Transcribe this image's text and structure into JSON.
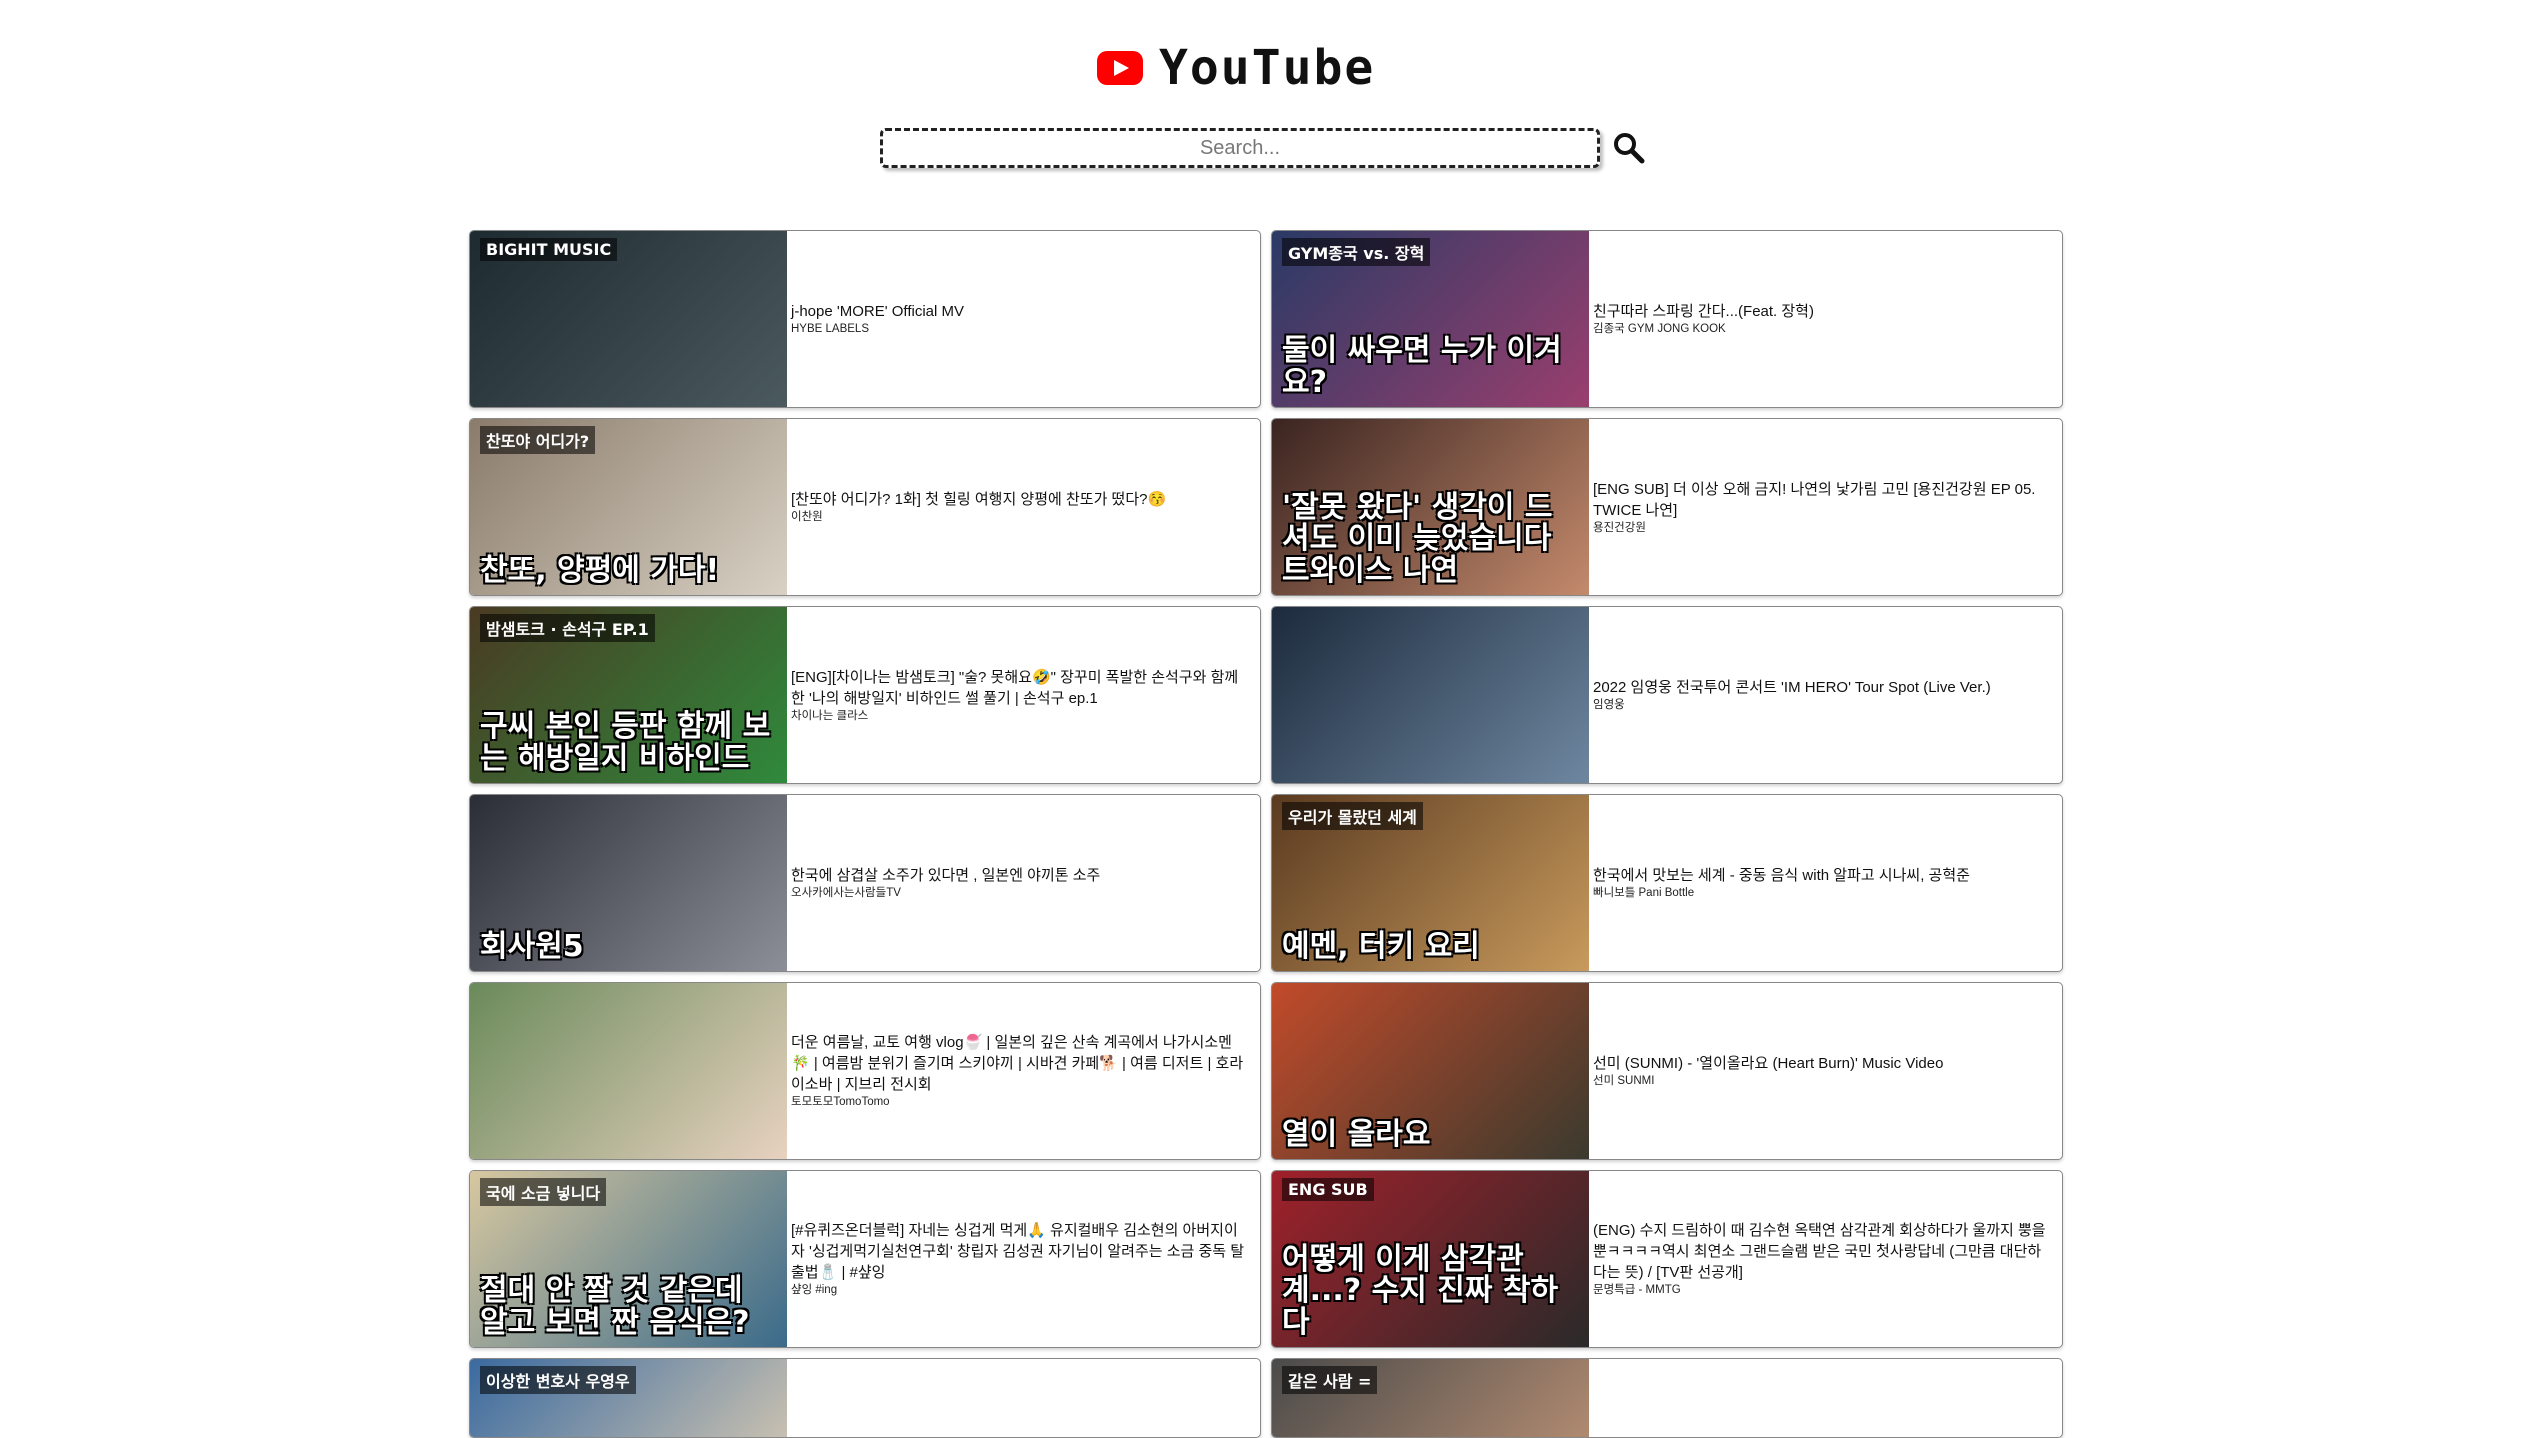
{
  "header": {
    "logo_text": "YouTube"
  },
  "search": {
    "placeholder": "Search..."
  },
  "videos": [
    {
      "title": "j-hope 'MORE' Official MV",
      "channel": "HYBE LABELS",
      "thumb_caption": "",
      "thumb_tag": "BIGHIT MUSIC",
      "thumb_colors": [
        "#1d2a30",
        "#4b5a5e"
      ]
    },
    {
      "title": "친구따라 스파링 간다...(Feat. 장혁)",
      "channel": "김종국 GYM JONG KOOK",
      "thumb_caption": "둘이 싸우면 누가 이겨요?",
      "thumb_tag": "GYM종국 vs. 장혁",
      "thumb_colors": [
        "#2a3a66",
        "#9a3f6e"
      ]
    },
    {
      "title": "[찬또야 어디가? 1화] 첫 힐링 여행지 양평에 찬또가 떴다?😚",
      "channel": "이찬원",
      "thumb_caption": "찬또, 양평에 가다!",
      "thumb_tag": "찬또야 어디가?",
      "thumb_colors": [
        "#8a7b6a",
        "#d8d1c4"
      ]
    },
    {
      "title": "[ENG SUB] 더 이상 오해 금지! 나연의 낯가림 고민 [용진건강원 EP 05. TWICE 나연]",
      "channel": "용진건강원",
      "thumb_caption": "'잘못 왔다' 생각이 드셔도 이미 늦었습니다 트와이스 나연",
      "thumb_tag": "",
      "thumb_colors": [
        "#3a2420",
        "#c48a6c"
      ]
    },
    {
      "title": "[ENG][차이나는 밤샘토크] \"술? 못해요🤣\" 장꾸미 폭발한 손석구와 함께한 '나의 해방일지' 비하인드 썰 풀기 | 손석구 ep.1",
      "channel": "차이나는 클라스",
      "thumb_caption": "구씨 본인 등판 함께 보는 해방일지 비하인드",
      "thumb_tag": "밤샘토크 · 손석구 EP.1",
      "thumb_colors": [
        "#4a3a22",
        "#2f8a3c"
      ]
    },
    {
      "title": "2022 임영웅 전국투어 콘서트 'IM HERO' Tour Spot (Live Ver.)",
      "channel": "임영웅",
      "thumb_caption": "",
      "thumb_tag": "",
      "thumb_colors": [
        "#1c2a3c",
        "#6e87a0"
      ]
    },
    {
      "title": "한국에 삼겹살 소주가 있다면 , 일본엔 야끼톤 소주",
      "channel": "오사카에사는사람들TV",
      "thumb_caption": "회사원5",
      "thumb_tag": "",
      "thumb_colors": [
        "#2a2c36",
        "#8c8e98"
      ]
    },
    {
      "title": "한국에서 맛보는 세계 - 중동 음식 with 알파고 시나씨, 공혁준",
      "channel": "빠니보틀 Pani Bottle",
      "thumb_caption": "예멘, 터키 요리",
      "thumb_tag": "우리가 몰랐던 세계",
      "thumb_colors": [
        "#5a3a20",
        "#c89a5c"
      ]
    },
    {
      "title": "더운 여름날, 교토 여행 vlog🍧 | 일본의 깊은 산속 계곡에서 나가시소멘🎋 | 여름밤 분위기 즐기며 스키야끼 | 시바견 카페🐕 | 여름 디저트 | 호라이소바 | 지브리 전시회",
      "channel": "토모토모TomoTomo",
      "thumb_caption": "",
      "thumb_tag": "",
      "thumb_colors": [
        "#6a8a5a",
        "#e8d2c0"
      ]
    },
    {
      "title": "선미 (SUNMI) - '열이올라요 (Heart Burn)' Music Video",
      "channel": "선미 SUNMI",
      "thumb_caption": "열이 올라요",
      "thumb_tag": "",
      "thumb_colors": [
        "#c24a2a",
        "#3a3a2e"
      ]
    },
    {
      "title": "[#유퀴즈온더블럭] 자네는 싱겁게 먹게🙏 유지컬배우 김소현의 아버지이자 '싱겁게먹기실천연구회' 창립자 김성권 자기님이 알려주는 소금 중독 탈출법🧂 | #샾잉",
      "channel": "샾잉 #ing",
      "thumb_caption": "절대 안 짤 것 같은데 알고 보면 짠 음식은?",
      "thumb_tag": "국에 소금 넣니다",
      "thumb_colors": [
        "#d8c8a0",
        "#3a6a8a"
      ]
    },
    {
      "title": "(ENG) 수지 드림하이 때 김수현 옥택연 삼각관계 회상하다가 울까지 뿡을 뿐ㅋㅋㅋㅋ역시 최연소 그랜드슬램 받은 국민 첫사랑답네 (그만큼 대단하다는 뜻) / [TV판 선공개]",
      "channel": "문명특급 - MMTG",
      "thumb_caption": "어떻게 이게 삼각관계...? 수지 진짜 착하다",
      "thumb_tag": "ENG SUB",
      "thumb_colors": [
        "#a0202a",
        "#2a2a2a"
      ]
    },
    {
      "title": "",
      "channel": "",
      "thumb_caption": "",
      "thumb_tag": "이상한 변호사 우영우",
      "thumb_colors": [
        "#3a6aa0",
        "#c8c0b0"
      ]
    },
    {
      "title": "",
      "channel": "",
      "thumb_caption": "",
      "thumb_tag": "같은 사람 =",
      "thumb_colors": [
        "#4a4a4a",
        "#b08a70"
      ]
    }
  ]
}
